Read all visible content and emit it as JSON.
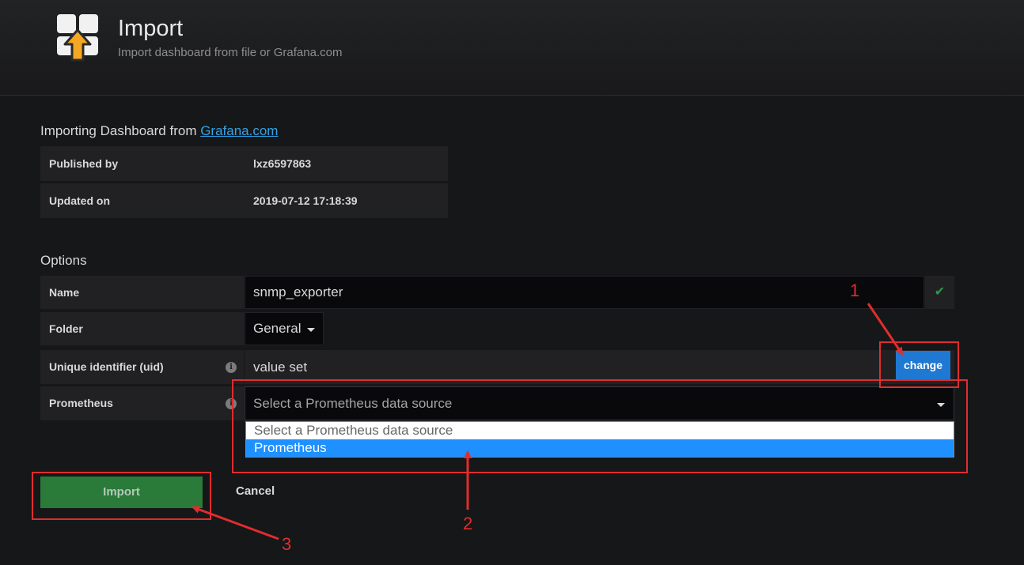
{
  "header": {
    "title": "Import",
    "subtitle": "Import dashboard from file or Grafana.com"
  },
  "source": {
    "heading_prefix": "Importing Dashboard from ",
    "link": "Grafana.com",
    "published_by_label": "Published by",
    "published_by_value": "lxz6597863",
    "updated_on_label": "Updated on",
    "updated_on_value": "2019-07-12 17:18:39"
  },
  "options": {
    "heading": "Options",
    "name_label": "Name",
    "name_value": "snmp_exporter",
    "folder_label": "Folder",
    "folder_value": "General",
    "uid_label": "Unique identifier (uid)",
    "uid_value": "value set",
    "change_label": "change",
    "prometheus_label": "Prometheus",
    "prometheus_placeholder": "Select a Prometheus data source",
    "prometheus_options": [
      "Select a Prometheus data source",
      "Prometheus"
    ],
    "prometheus_highlighted": "Prometheus"
  },
  "actions": {
    "import_label": "Import",
    "cancel_label": "Cancel"
  },
  "annotations": {
    "step1": "1",
    "step2": "2",
    "step3": "3",
    "color": "#e02d2d"
  },
  "colors": {
    "background": "#161719",
    "link": "#33a2e5",
    "primary_button": "#1f78d1",
    "success_button": "#2a7a3a",
    "selected_option": "#1e90ff",
    "logo_arrow": "#f5a623"
  },
  "icons": {
    "logo": "import-dashboard-icon",
    "valid": "check-icon",
    "info": "info-circle-icon",
    "dropdown": "caret-down-icon"
  }
}
